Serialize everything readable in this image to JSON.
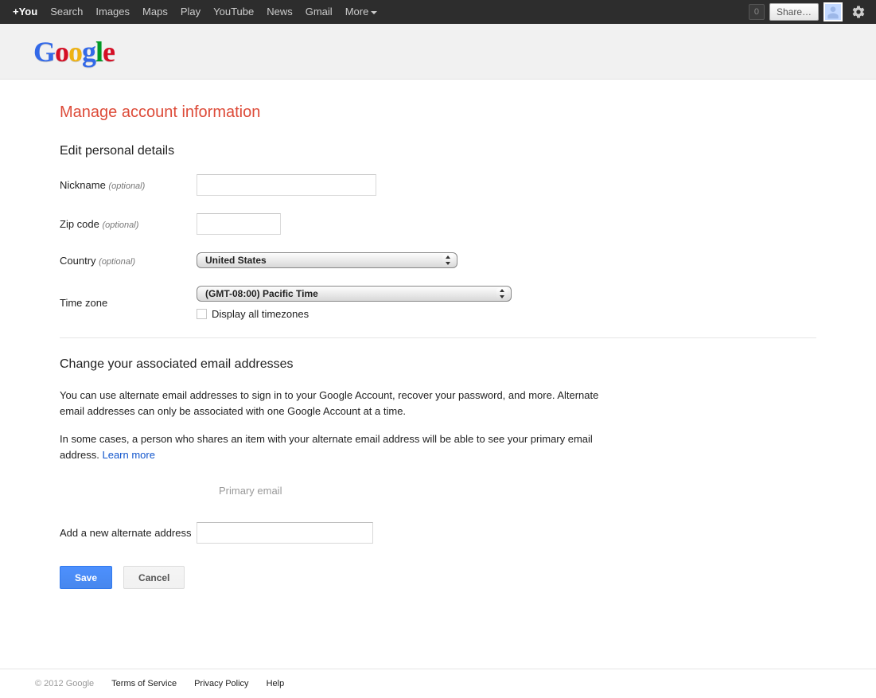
{
  "topnav": {
    "items": [
      "+You",
      "Search",
      "Images",
      "Maps",
      "Play",
      "YouTube",
      "News",
      "Gmail",
      "More"
    ],
    "badge": "0",
    "share": "Share…"
  },
  "page": {
    "title": "Manage account information"
  },
  "personal": {
    "heading": "Edit personal details",
    "nickname_label": "Nickname",
    "zip_label": "Zip code",
    "country_label": "Country",
    "tz_label": "Time zone",
    "optional": "(optional)",
    "country_value": "United States",
    "tz_value": "(GMT-08:00) Pacific Time",
    "display_all_tz": "Display all timezones"
  },
  "email": {
    "heading": "Change your associated email addresses",
    "p1": "You can use alternate email addresses to sign in to your Google Account, recover your password, and more. Alternate email addresses can only be associated with one Google Account at a time.",
    "p2a": "In some cases, a person who shares an item with your alternate email address will be able to see your primary email address. ",
    "learn_more": "Learn more",
    "primary_label": "Primary email",
    "add_alt_label": "Add a new alternate address"
  },
  "buttons": {
    "save": "Save",
    "cancel": "Cancel"
  },
  "footer": {
    "copy": "© 2012 Google",
    "terms": "Terms of Service",
    "privacy": "Privacy Policy",
    "help": "Help"
  }
}
